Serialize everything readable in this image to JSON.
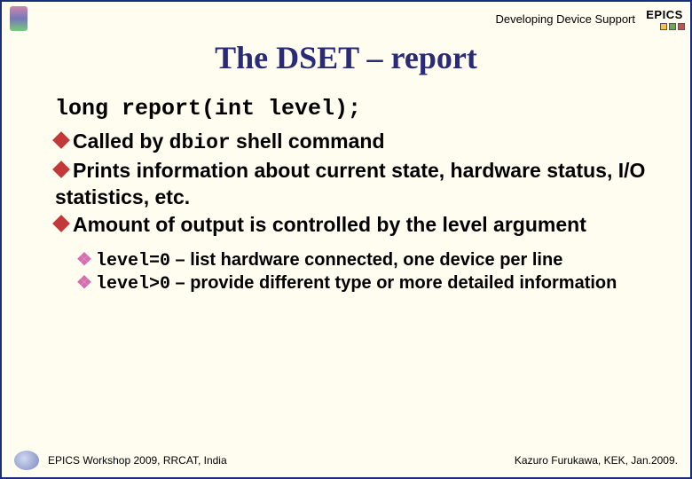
{
  "header": {
    "topic": "Developing Device Support",
    "epics_label": "EPICS"
  },
  "title": "The DSET – report",
  "signature": "long report(int level);",
  "bullets": {
    "b1_pre": "Called by ",
    "b1_code": "dbior",
    "b1_post": " shell command",
    "b2": "Prints information about current state, hardware status, I/O statistics, etc.",
    "b3": "Amount of output is controlled by the level argument"
  },
  "sub": {
    "s1_code": "level=0",
    "s1_text": " – list hardware connected, one device per line",
    "s2_code": "level>0",
    "s2_text": " – provide different type or more detailed information"
  },
  "footer": {
    "left": "EPICS Workshop 2009, RRCAT, India",
    "right": "Kazuro Furukawa, KEK, Jan.2009."
  }
}
